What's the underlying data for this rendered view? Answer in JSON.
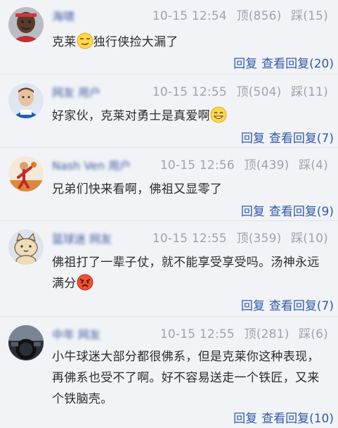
{
  "comments": [
    {
      "username": "海啸",
      "date": "10-15 12:54",
      "up_label": "顶",
      "up_count": "856",
      "down_label": "踩",
      "down_count": "15",
      "text_before": "克莱",
      "text_after": "独行侠捡大漏了",
      "emoji": "smirk-emoji-icon",
      "reply_label": "回复",
      "view_replies_label": "查看回复",
      "reply_count": "20"
    },
    {
      "username": "网友 用户",
      "date": "10-15 12:55",
      "up_label": "顶",
      "up_count": "504",
      "down_label": "踩",
      "down_count": "11",
      "text_before": "好家伙，克莱对勇士是真爱啊",
      "text_after": "",
      "emoji": "grin-emoji-icon",
      "reply_label": "回复",
      "view_replies_label": "查看回复",
      "reply_count": "7"
    },
    {
      "username": "Nash Ven 用户",
      "date": "10-15 12:56",
      "up_label": "顶",
      "up_count": "439",
      "down_label": "踩",
      "down_count": "4",
      "text_before": "兄弟们快来看啊，佛祖又显零了",
      "text_after": "",
      "emoji": "",
      "reply_label": "回复",
      "view_replies_label": "查看回复",
      "reply_count": "9"
    },
    {
      "username": "篮球迷 网友",
      "date": "10-15 12:55",
      "up_label": "顶",
      "up_count": "359",
      "down_label": "踩",
      "down_count": "10",
      "text_before": "佛祖打了一辈子仗，就不能享受享受吗。汤神永远满分",
      "text_after": "",
      "emoji": "angry-emoji-icon",
      "reply_label": "回复",
      "view_replies_label": "查看回复",
      "reply_count": "7"
    },
    {
      "username": "中年 网友",
      "date": "10-15 12:55",
      "up_label": "顶",
      "up_count": "281",
      "down_label": "踩",
      "down_count": "6",
      "text_before": "小牛球迷大部分都很佛系，但是克莱你这种表现，再佛系也受不了啊。好不容易送走一个铁匠，又来个铁脑壳。",
      "text_after": "",
      "emoji": "",
      "reply_label": "回复",
      "view_replies_label": "查看回复",
      "reply_count": "10"
    }
  ],
  "colors": {
    "background": "#f2f3f7",
    "link": "#2f5aa8",
    "meta": "#9ea3ad",
    "username": "#3d5ea0"
  }
}
